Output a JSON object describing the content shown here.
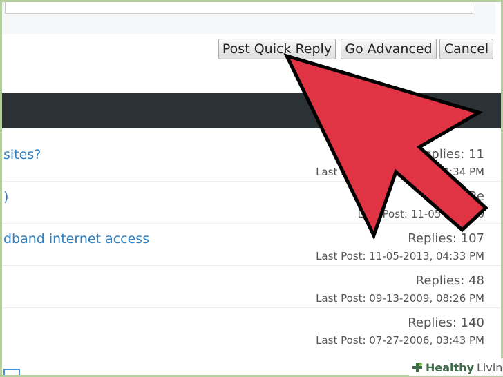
{
  "reply_actions": {
    "post_quick_reply": "Post Quick Reply",
    "go_advanced": "Go Advanced",
    "cancel": "Cancel"
  },
  "threads": [
    {
      "title": "sites?",
      "replies": "Replies: 11",
      "last_post": "Last Post: 11-05-2013, 04:34 PM",
      "visible_replies": "Replies: 11",
      "visible_last_post_left": "Last",
      "visible_last_post_right": "34 PM"
    },
    {
      "title": ")",
      "replies": "Re",
      "last_post": "Last Post: 11-05-2013, 0",
      "visible_replies": "Re",
      "visible_last_post_left": "Last Post",
      "visible_last_post_right": "05-2013, 0"
    },
    {
      "title": "dband internet access",
      "replies": "Replies: 107",
      "last_post": "Last Post: 11-05-2013, 04:33 PM"
    },
    {
      "title": "",
      "replies": "Replies: 48",
      "last_post": "Last Post: 09-13-2009, 08:26 PM"
    },
    {
      "title": "",
      "replies": "Replies: 140",
      "last_post": "Last Post: 07-27-2006, 03:43 PM"
    }
  ],
  "watermark": {
    "brand_bold": "Healthy",
    "brand_regular": "Living",
    "icon": "plus-leaf-icon"
  },
  "overlay": {
    "icon": "red-arrow-pointer",
    "color": "#e03444"
  }
}
